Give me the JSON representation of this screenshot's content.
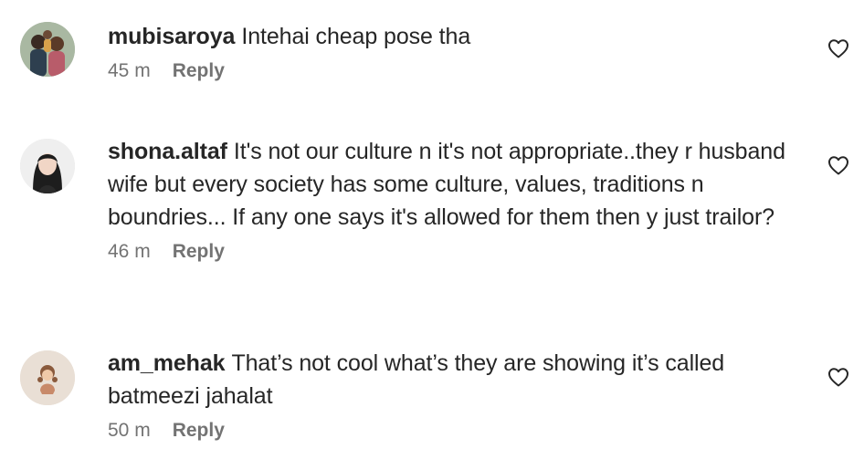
{
  "comments": [
    {
      "username": "mubisaroya",
      "text": "Intehai cheap pose tha",
      "time": "45 m",
      "reply_label": "Reply",
      "avatar_icon": "family-illustration-avatar",
      "like_icon": "heart-outline-icon"
    },
    {
      "username": "shona.altaf",
      "text": "It's not our culture n it's not appropriate..they r husband wife but every society has some culture, values, traditions n boundries... If any one says it's allowed for them then y just trailor?",
      "time": "46 m",
      "reply_label": "Reply",
      "avatar_icon": "woman-photo-avatar",
      "like_icon": "heart-outline-icon"
    },
    {
      "username": "am_mehak",
      "text": "That’s not cool what’s they are showing it’s called batmeezi jahalat",
      "time": "50 m",
      "reply_label": "Reply",
      "avatar_icon": "cartoon-girl-avatar",
      "like_icon": "heart-outline-icon"
    }
  ],
  "colors": {
    "text": "#262626",
    "meta": "#737373",
    "background": "#ffffff"
  }
}
